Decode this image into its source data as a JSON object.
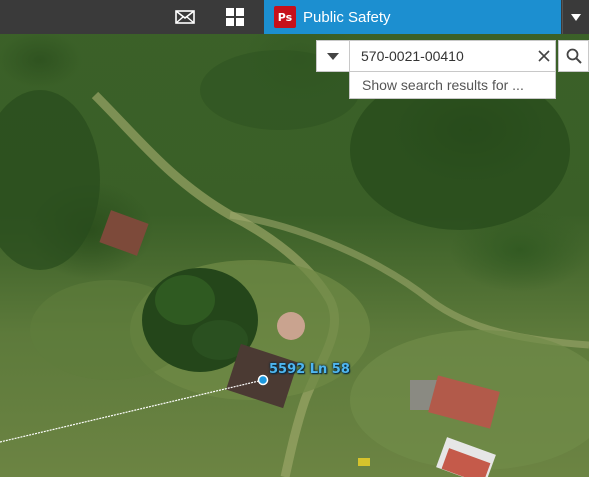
{
  "header": {
    "mail_icon": "envelope-icon",
    "apps_icon": "grid-icon",
    "app_title": "Public Safety",
    "app_logo_text": "Ps",
    "app_logo_color": "#c7101a",
    "accent_color": "#1c8fd0",
    "dropdown_icon": "caret-down-icon"
  },
  "search": {
    "value": "570-0021-00410",
    "suggestion": "Show search results for ...",
    "source_icon": "caret-down-icon",
    "clear_icon": "close-icon",
    "search_icon": "search-icon"
  },
  "map": {
    "parcel_label": "5592 Ln 58",
    "line_color": "#ffffff",
    "point_color": "#1e9ae0"
  }
}
